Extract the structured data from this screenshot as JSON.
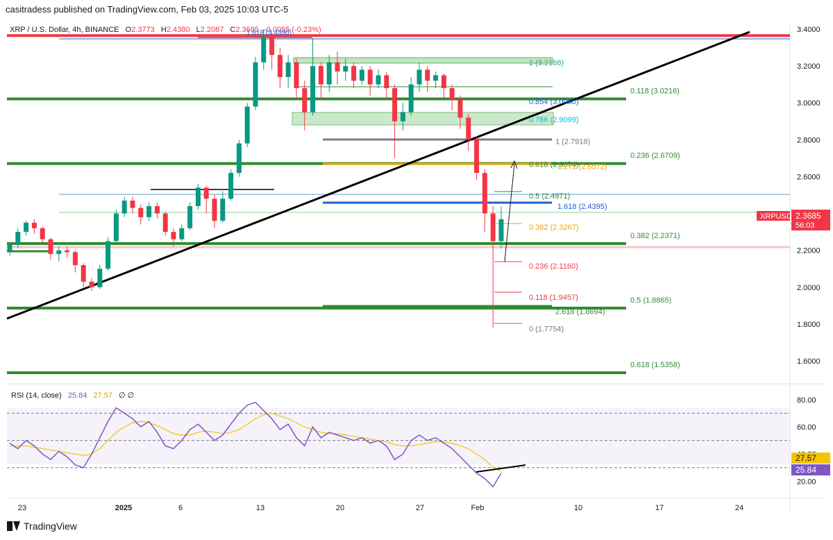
{
  "publisher": "casitradess published on TradingView.com, Feb 03, 2025 10:03 UTC-5",
  "header": {
    "symbol": "XRP / U.S. Dollar, 4h, BINANCE",
    "o_label": "O",
    "o_val": "2.3773",
    "h_label": "H",
    "h_val": "2.4380",
    "l_label": "L",
    "l_val": "2.2087",
    "c_label": "C",
    "c_val": "2.3685",
    "change": "-0.0055 (-0.23%)",
    "top_overlay": "1.618 (3.4390)"
  },
  "colors": {
    "up": "#089981",
    "down": "#f23645",
    "green_line": "#2e8b2e",
    "trend": "#000000",
    "orange": "#f5a100",
    "blue": "#1f5fd6",
    "gray": "#787b86",
    "rsi": "#7e57c2",
    "rsi_ma": "#f5c400"
  },
  "chart_data": {
    "type": "candlestick",
    "symbol": "XRPUSD",
    "price_axis_ticks": [
      "3.4000",
      "3.2000",
      "3.0000",
      "2.8000",
      "2.6000",
      "2.4000",
      "2.2000",
      "2.0000",
      "1.8000",
      "1.6000"
    ],
    "ylim": [
      1.45,
      3.45
    ],
    "x_ticks": [
      "23",
      "2025",
      "6",
      "13",
      "20",
      "27",
      "Feb",
      "10",
      "17",
      "24"
    ],
    "last_price": "2.3685",
    "countdown": "56:03",
    "candles": [
      [
        2.2,
        2.23,
        2.17,
        2.24
      ],
      [
        2.23,
        2.3,
        2.21,
        2.32
      ],
      [
        2.3,
        2.35,
        2.28,
        2.36
      ],
      [
        2.35,
        2.32,
        2.29,
        2.37
      ],
      [
        2.32,
        2.26,
        2.24,
        2.33
      ],
      [
        2.26,
        2.18,
        2.15,
        2.27
      ],
      [
        2.18,
        2.2,
        2.14,
        2.22
      ],
      [
        2.2,
        2.19,
        2.16,
        2.22
      ],
      [
        2.19,
        2.12,
        2.08,
        2.2
      ],
      [
        2.12,
        2.03,
        2.0,
        2.13
      ],
      [
        2.03,
        2.0,
        1.98,
        2.05
      ],
      [
        2.0,
        2.1,
        1.99,
        2.12
      ],
      [
        2.1,
        2.25,
        2.09,
        2.27
      ],
      [
        2.25,
        2.4,
        2.24,
        2.42
      ],
      [
        2.4,
        2.47,
        2.38,
        2.49
      ],
      [
        2.47,
        2.43,
        2.4,
        2.49
      ],
      [
        2.43,
        2.38,
        2.34,
        2.45
      ],
      [
        2.38,
        2.44,
        2.36,
        2.46
      ],
      [
        2.44,
        2.4,
        2.37,
        2.46
      ],
      [
        2.4,
        2.3,
        2.28,
        2.41
      ],
      [
        2.3,
        2.26,
        2.22,
        2.32
      ],
      [
        2.26,
        2.32,
        2.25,
        2.34
      ],
      [
        2.32,
        2.44,
        2.31,
        2.46
      ],
      [
        2.44,
        2.54,
        2.42,
        2.56
      ],
      [
        2.54,
        2.48,
        2.4,
        2.55
      ],
      [
        2.48,
        2.36,
        2.32,
        2.5
      ],
      [
        2.36,
        2.48,
        2.35,
        2.52
      ],
      [
        2.48,
        2.62,
        2.47,
        2.64
      ],
      [
        2.62,
        2.78,
        2.6,
        2.8
      ],
      [
        2.78,
        2.98,
        2.76,
        3.0
      ],
      [
        2.98,
        3.22,
        2.96,
        3.25
      ],
      [
        3.22,
        3.36,
        3.18,
        3.4
      ],
      [
        3.36,
        3.26,
        3.18,
        3.38
      ],
      [
        3.26,
        3.14,
        3.08,
        3.3
      ],
      [
        3.14,
        3.22,
        3.08,
        3.26
      ],
      [
        3.22,
        3.08,
        3.02,
        3.24
      ],
      [
        3.08,
        2.95,
        2.85,
        3.12
      ],
      [
        2.95,
        3.2,
        2.93,
        3.35
      ],
      [
        3.2,
        3.1,
        3.02,
        3.22
      ],
      [
        3.1,
        3.22,
        3.06,
        3.26
      ],
      [
        3.22,
        3.17,
        3.1,
        3.28
      ],
      [
        3.17,
        3.2,
        3.12,
        3.24
      ],
      [
        3.2,
        3.12,
        3.08,
        3.22
      ],
      [
        3.12,
        3.18,
        3.1,
        3.2
      ],
      [
        3.18,
        3.1,
        3.04,
        3.2
      ],
      [
        3.1,
        3.15,
        3.08,
        3.18
      ],
      [
        3.15,
        3.08,
        3.02,
        3.17
      ],
      [
        3.08,
        2.9,
        2.7,
        3.1
      ],
      [
        2.9,
        2.95,
        2.85,
        3.0
      ],
      [
        2.95,
        3.1,
        2.93,
        3.14
      ],
      [
        3.1,
        3.18,
        3.06,
        3.22
      ],
      [
        3.18,
        3.12,
        3.06,
        3.2
      ],
      [
        3.12,
        3.15,
        3.08,
        3.17
      ],
      [
        3.15,
        3.08,
        3.02,
        3.16
      ],
      [
        3.08,
        3.02,
        2.96,
        3.1
      ],
      [
        3.02,
        2.92,
        2.86,
        3.04
      ],
      [
        2.92,
        2.8,
        2.74,
        2.94
      ],
      [
        2.8,
        2.62,
        2.58,
        2.82
      ],
      [
        2.62,
        2.4,
        2.3,
        2.64
      ],
      [
        2.4,
        2.25,
        1.78,
        2.44
      ],
      [
        2.25,
        2.3685,
        2.2087,
        2.438
      ]
    ],
    "horizontal_levels": [
      {
        "price": 3.365,
        "color": "#f23645",
        "label": ""
      },
      {
        "price": 3.0216,
        "color": "#2e8b2e",
        "label": "0.118 (3.0216)"
      },
      {
        "price": 2.6709,
        "color": "#2e8b2e",
        "label": "0.236 (2.6709)"
      },
      {
        "price": 2.2371,
        "color": "#2e8b2e",
        "label": "0.382 (2.2371)"
      },
      {
        "price": 1.8865,
        "color": "#2e8b2e",
        "label": "0.5 (1.8865)"
      },
      {
        "price": 1.5358,
        "color": "#2e8b2e",
        "label": "0.618 (1.5358)"
      }
    ],
    "fib_labels": [
      {
        "text": "1 (3.2188)",
        "price": 3.2188,
        "color": "#26a69a"
      },
      {
        "text": "0.854 (3.0080)",
        "price": 3.008,
        "color": "#1f5fd6"
      },
      {
        "text": "0.786 (2.9099)",
        "price": 2.9099,
        "color": "#00bcd4"
      },
      {
        "text": "1 (2.7918)",
        "price": 2.7918,
        "color": "#787b86"
      },
      {
        "text": "0.618 (2.6674)",
        "price": 2.6674,
        "color": "#2e8b2e"
      },
      {
        "text": "1.272 (2.6572)",
        "price": 2.6572,
        "color": "#f5a100"
      },
      {
        "text": "0.5 (2.4971)",
        "price": 2.4971,
        "color": "#2e8b2e"
      },
      {
        "text": "1.618 (2.4395)",
        "price": 2.4395,
        "color": "#1f5fd6"
      },
      {
        "text": "0.382 (2.3267)",
        "price": 2.3267,
        "color": "#f5a100"
      },
      {
        "text": "0.236 (2.1160)",
        "price": 2.116,
        "color": "#f23645"
      },
      {
        "text": "0.118 (1.9457)",
        "price": 1.9457,
        "color": "#f23645"
      },
      {
        "text": "2.618 (1.8694)",
        "price": 1.8694,
        "color": "#2e8b2e"
      },
      {
        "text": "0 (1.7754)",
        "price": 1.7754,
        "color": "#787b86"
      }
    ],
    "rsi": {
      "title": "RSI (14, close)",
      "value": "25.84",
      "ma_value": "27.57",
      "extra": "∅ ∅",
      "ticks": [
        "80.00",
        "60.00",
        "40.00",
        "20.00"
      ],
      "ylim": [
        10,
        85
      ],
      "upper": 70,
      "mid": 50,
      "lower": 30,
      "values": [
        48,
        44,
        50,
        46,
        40,
        36,
        42,
        38,
        32,
        30,
        40,
        52,
        64,
        74,
        70,
        66,
        60,
        64,
        56,
        46,
        44,
        50,
        58,
        62,
        56,
        50,
        54,
        62,
        70,
        76,
        78,
        72,
        66,
        58,
        62,
        52,
        46,
        60,
        52,
        56,
        54,
        52,
        50,
        52,
        48,
        50,
        46,
        36,
        40,
        50,
        54,
        50,
        52,
        48,
        44,
        38,
        32,
        26,
        22,
        16,
        26
      ],
      "ma": [
        46,
        46,
        46,
        45,
        44,
        43,
        42,
        41,
        40,
        39,
        40,
        44,
        50,
        56,
        60,
        63,
        64,
        63,
        61,
        58,
        55,
        54,
        54,
        56,
        57,
        56,
        55,
        56,
        58,
        62,
        66,
        69,
        70,
        68,
        66,
        63,
        60,
        58,
        56,
        55,
        55,
        54,
        53,
        52,
        51,
        50,
        49,
        47,
        46,
        46,
        47,
        48,
        49,
        49,
        48,
        46,
        44,
        40,
        36,
        30,
        27.57
      ]
    }
  }
}
